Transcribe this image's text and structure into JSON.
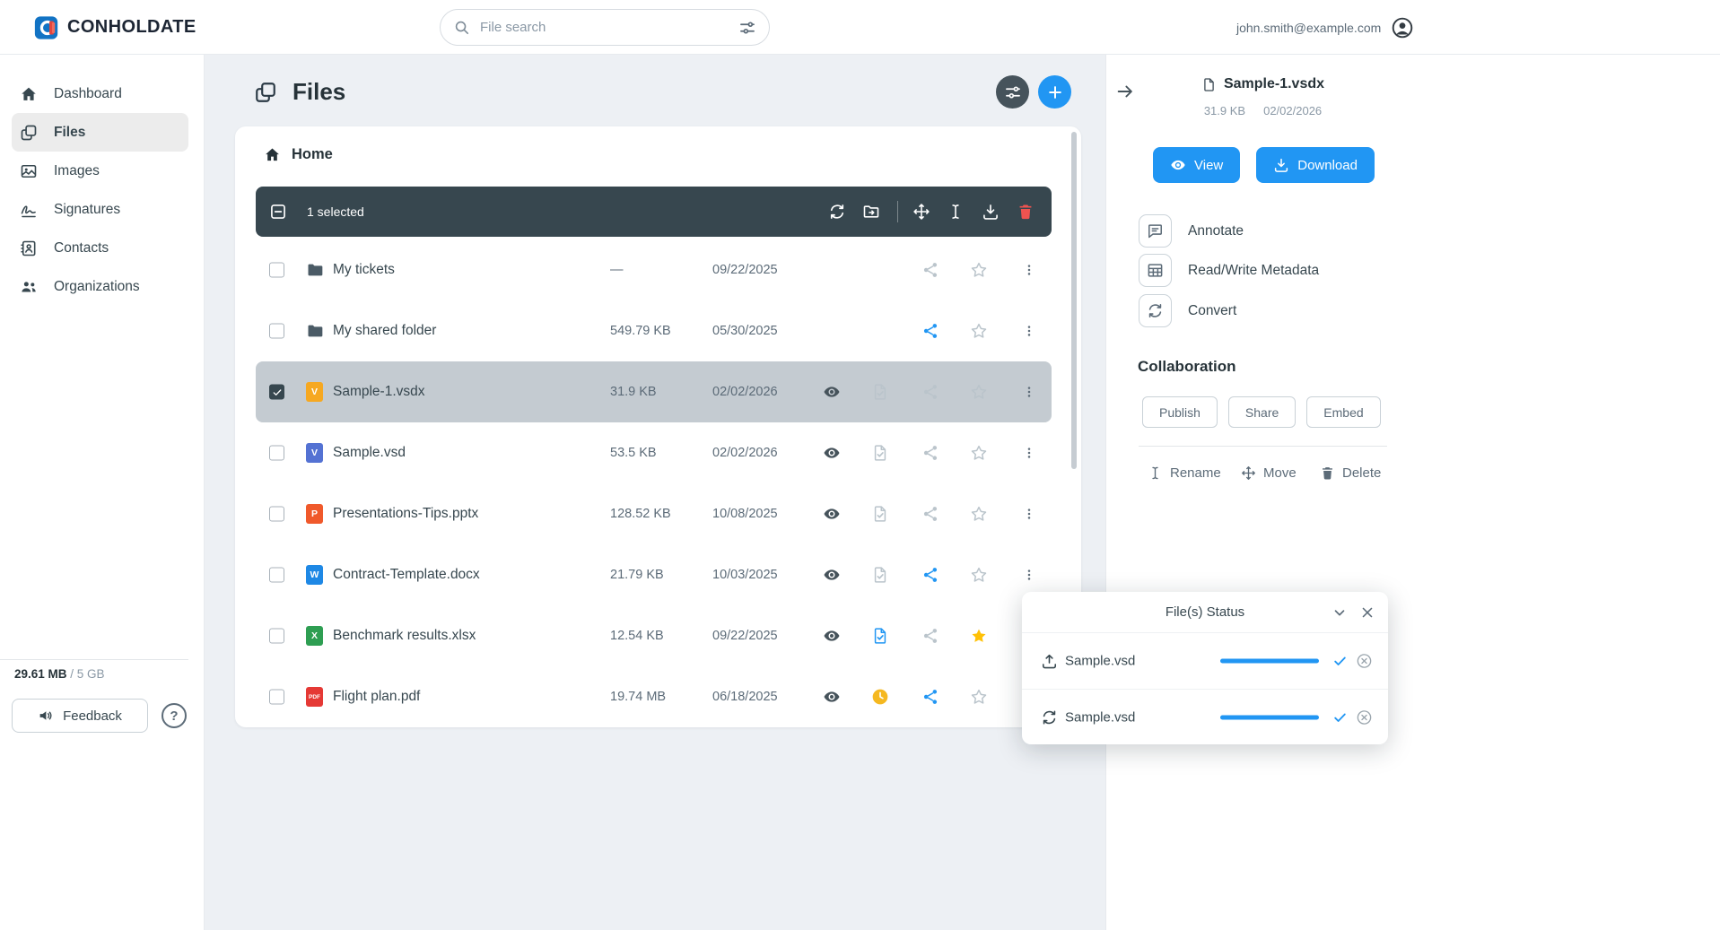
{
  "header": {
    "brand": "CONHOLDATE",
    "search_placeholder": "File search",
    "account_email": "john.smith@example.com"
  },
  "sidebar": {
    "items": [
      {
        "label": "Dashboard",
        "icon": "home",
        "active": false
      },
      {
        "label": "Files",
        "icon": "files",
        "active": true
      },
      {
        "label": "Images",
        "icon": "images",
        "active": false
      },
      {
        "label": "Signatures",
        "icon": "signature",
        "active": false
      },
      {
        "label": "Contacts",
        "icon": "contacts",
        "active": false
      },
      {
        "label": "Organizations",
        "icon": "organizations",
        "active": false
      }
    ],
    "storage_used": "29.61 MB",
    "storage_total": "/ 5 GB",
    "feedback_label": "Feedback",
    "help_label": "?"
  },
  "main": {
    "title": "Files",
    "breadcrumb": "Home",
    "toolbar": {
      "selected_count": "1 selected"
    },
    "rows": [
      {
        "name": "My tickets",
        "kind": "folder",
        "size": "—",
        "date": "09/22/2025",
        "checked": false,
        "selected": false,
        "eye": false,
        "status": "none",
        "share": "inactive",
        "star": "inactive"
      },
      {
        "name": "My shared folder",
        "kind": "folder",
        "size": "549.79 KB",
        "date": "05/30/2025",
        "checked": false,
        "selected": false,
        "eye": false,
        "status": "none",
        "share": "shared",
        "star": "inactive"
      },
      {
        "name": "Sample-1.vsdx",
        "kind": "file",
        "badge": {
          "label": "V",
          "color": "#f6a821"
        },
        "size": "31.9 KB",
        "date": "02/02/2026",
        "checked": true,
        "selected": true,
        "eye": true,
        "status": "ready-inactive",
        "share": "inactive",
        "star": "inactive"
      },
      {
        "name": "Sample.vsd",
        "kind": "file",
        "badge": {
          "label": "V",
          "color": "#5472d3"
        },
        "size": "53.5 KB",
        "date": "02/02/2026",
        "checked": false,
        "selected": false,
        "eye": true,
        "status": "ready-inactive",
        "share": "inactive",
        "star": "inactive"
      },
      {
        "name": "Presentations-Tips.pptx",
        "kind": "file",
        "badge": {
          "label": "P",
          "color": "#f0592b"
        },
        "size": "128.52 KB",
        "date": "10/08/2025",
        "checked": false,
        "selected": false,
        "eye": true,
        "status": "ready-inactive",
        "share": "inactive",
        "star": "inactive"
      },
      {
        "name": "Contract-Template.docx",
        "kind": "file",
        "badge": {
          "label": "W",
          "color": "#1e88e5"
        },
        "size": "21.79 KB",
        "date": "10/03/2025",
        "checked": false,
        "selected": false,
        "eye": true,
        "status": "ready-inactive",
        "share": "shared",
        "star": "inactive"
      },
      {
        "name": "Benchmark results.xlsx",
        "kind": "file",
        "badge": {
          "label": "X",
          "color": "#2e9e52"
        },
        "size": "12.54 KB",
        "date": "09/22/2025",
        "checked": false,
        "selected": false,
        "eye": true,
        "status": "converted",
        "share": "inactive",
        "star": "favorite"
      },
      {
        "name": "Flight plan.pdf",
        "kind": "file",
        "badge": {
          "label": "PDF",
          "color": "#e53935"
        },
        "size": "19.74 MB",
        "date": "06/18/2025",
        "checked": false,
        "selected": false,
        "eye": true,
        "status": "pending",
        "share": "shared",
        "star": "inactive"
      }
    ]
  },
  "details": {
    "file_name": "Sample-1.vsdx",
    "file_size": "31.9 KB",
    "file_date": "02/02/2026",
    "view_label": "View",
    "download_label": "Download",
    "actions": [
      {
        "label": "Annotate",
        "icon": "comment"
      },
      {
        "label": "Read/Write Metadata",
        "icon": "table"
      },
      {
        "label": "Convert",
        "icon": "refresh"
      }
    ],
    "collaboration_title": "Collaboration",
    "collab_buttons": [
      "Publish",
      "Share",
      "Embed"
    ],
    "footer_actions": [
      {
        "label": "Rename",
        "icon": "ibeam"
      },
      {
        "label": "Move",
        "icon": "move"
      },
      {
        "label": "Delete",
        "icon": "trash"
      }
    ]
  },
  "status_popup": {
    "title": "File(s) Status",
    "items": [
      {
        "name": "Sample.vsd",
        "icon": "upload",
        "progress": 100
      },
      {
        "name": "Sample.vsd",
        "icon": "refresh",
        "progress": 100
      }
    ]
  },
  "colors": {
    "accent": "#2196f3",
    "toolbar_bg": "#37474f",
    "selected_row_bg": "#c4cbd1",
    "inactive_icon": "#bac4cb",
    "dark_icon": "#46535b",
    "danger": "#ef5350",
    "star_active": "#ffc107",
    "pending": "#f5b820"
  }
}
